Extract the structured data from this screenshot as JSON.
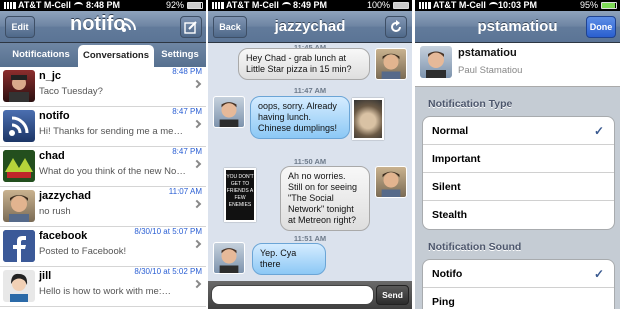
{
  "status1": {
    "carrier": "AT&T M-Cell",
    "time": "8:48 PM",
    "battery": "92%"
  },
  "status2": {
    "carrier": "AT&T M-Cell",
    "time": "8:49 PM",
    "battery": "100%"
  },
  "status3": {
    "carrier": "AT&T M-Cell",
    "time": "10:03 PM",
    "battery": "95%"
  },
  "screen1": {
    "edit": "Edit",
    "logo": "notifo",
    "tabs": [
      "Notifications",
      "Conversations",
      "Settings"
    ],
    "active_tab": "Conversations",
    "rows": [
      {
        "name": "n_jc",
        "message": "Taco Tuesday?",
        "date": "8:48 PM"
      },
      {
        "name": "notifo",
        "message": "Hi! Thanks for sending me a message…",
        "date": "8:47 PM"
      },
      {
        "name": "chad",
        "message": "What do you think of the new Notif…",
        "date": "8:47 PM"
      },
      {
        "name": "jazzychad",
        "message": "no rush",
        "date": "11:07 AM"
      },
      {
        "name": "facebook",
        "message": "Posted to Facebook!",
        "date": "8/30/10 at 5:07 PM"
      },
      {
        "name": "jill",
        "message": "Hello is how to work with me:…",
        "date": "8/30/10 at 5:02 PM"
      }
    ]
  },
  "screen2": {
    "back": "Back",
    "title": "jazzychad",
    "messages": [
      {
        "time": "11:45 AM",
        "text": "Hey Chad - grab lunch at Little Star pizza in 15 min?",
        "dir": "in"
      },
      {
        "time": "11:47 AM",
        "text": "oops, sorry. Already having lunch. Chinese dumplings!",
        "dir": "out"
      },
      {
        "time": "11:50 AM",
        "text": "Ah no worries. Still on for seeing \"The Social Network\" tonight at Metreon right?",
        "dir": "in"
      },
      {
        "time": "11:51 AM",
        "text": "Yep. Cya there",
        "dir": "out"
      }
    ],
    "book_text": "YOU DON'T GET TO FRIENDS A FEW ENEMIES",
    "send": "Send"
  },
  "screen3": {
    "title": "pstamatiou",
    "done": "Done",
    "username": "pstamatiou",
    "fullname": "Paul Stamatiou",
    "type_header": "Notification Type",
    "types": [
      "Normal",
      "Important",
      "Silent",
      "Stealth"
    ],
    "selected_type": "Normal",
    "sound_header": "Notification Sound",
    "sounds": [
      "Notifo",
      "Ping"
    ],
    "selected_sound": "Notifo"
  },
  "colors": {
    "nav": "#6d84a2",
    "link_blue": "#2a5fd4",
    "bubble_out": "#8cc8f5"
  }
}
